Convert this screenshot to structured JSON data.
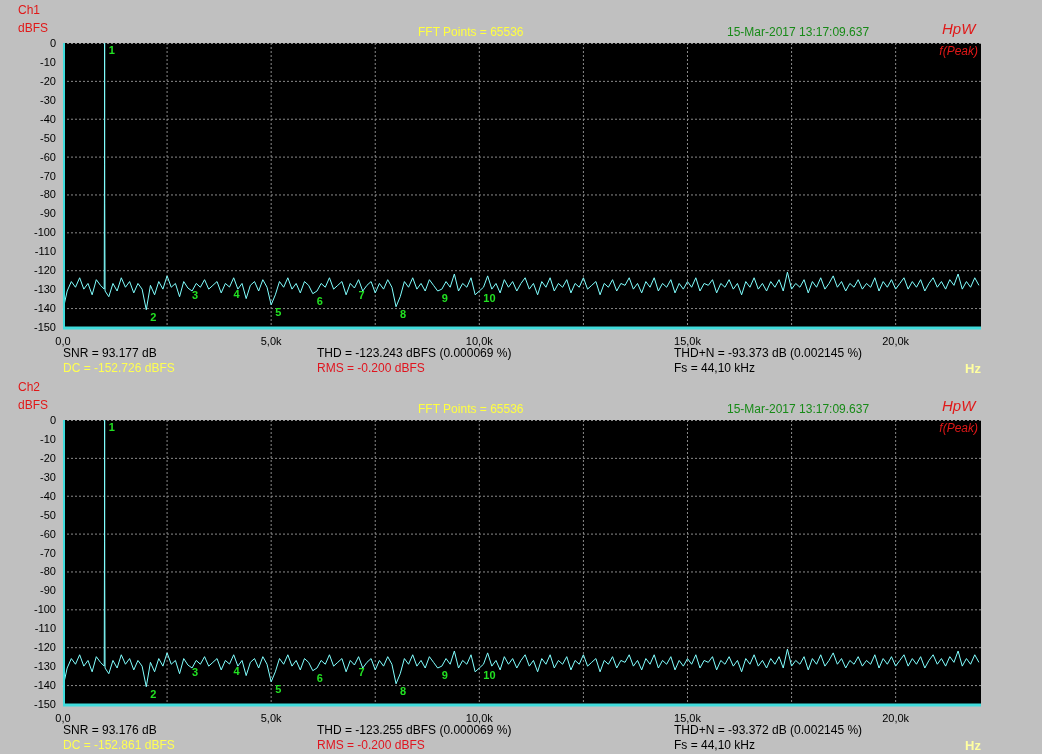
{
  "panels": [
    {
      "channel": "Ch1",
      "fft_points": "FFT Points = 65536",
      "timestamp": "15-Mar-2017 13:17:09.637",
      "brand": "HpW",
      "peak_mode": "f(Peak)",
      "chart_data": {
        "type": "line",
        "xlabel": "Hz",
        "ylabel": "dBFS",
        "grid": true,
        "xlim": [
          0,
          22050
        ],
        "ylim": [
          -150,
          0
        ],
        "xticks": [
          {
            "value": 0,
            "label": "0,0"
          },
          {
            "value": 5000,
            "label": "5,0k"
          },
          {
            "value": 10000,
            "label": "10,0k"
          },
          {
            "value": 15000,
            "label": "15,0k"
          },
          {
            "value": 20000,
            "label": "20,0k"
          }
        ],
        "yticks": [
          0,
          -10,
          -20,
          -30,
          -40,
          -50,
          -60,
          -70,
          -80,
          -90,
          -100,
          -110,
          -120,
          -130,
          -140,
          -150
        ],
        "x": [
          0,
          100,
          200,
          300,
          400,
          500,
          600,
          700,
          800,
          900,
          990,
          997,
          1000,
          1003,
          1010,
          1100,
          1200,
          1300,
          1400,
          1500,
          1600,
          1700,
          1800,
          1900,
          2000,
          2100,
          2200,
          2300,
          2400,
          2500,
          2600,
          2700,
          2800,
          2900,
          3000,
          3100,
          3200,
          3300,
          3400,
          3500,
          3600,
          3700,
          3800,
          3900,
          4000,
          4100,
          4200,
          4300,
          4400,
          4500,
          4600,
          4700,
          4800,
          4900,
          5000,
          5100,
          5200,
          5300,
          5400,
          5500,
          5600,
          5700,
          5800,
          5900,
          6000,
          6100,
          6200,
          6300,
          6400,
          6500,
          6600,
          6700,
          6800,
          6900,
          7000,
          7100,
          7200,
          7300,
          7400,
          7500,
          7600,
          7700,
          7800,
          7900,
          8000,
          8100,
          8200,
          8300,
          8400,
          8500,
          8600,
          8700,
          8800,
          8900,
          9000,
          9100,
          9200,
          9300,
          9400,
          9500,
          9600,
          9700,
          9800,
          9900,
          10000,
          10100,
          10200,
          10300,
          10400,
          10500,
          10600,
          10700,
          10800,
          10900,
          11000,
          11100,
          11200,
          11300,
          11400,
          11500,
          11600,
          11700,
          11800,
          11900,
          12000,
          12100,
          12200,
          12300,
          12400,
          12500,
          12600,
          12700,
          12800,
          12900,
          13000,
          13100,
          13200,
          13300,
          13400,
          13500,
          13600,
          13700,
          13800,
          13900,
          14000,
          14100,
          14200,
          14300,
          14400,
          14500,
          14600,
          14700,
          14800,
          14900,
          15000,
          15100,
          15200,
          15300,
          15400,
          15500,
          15600,
          15700,
          15800,
          15900,
          16000,
          16100,
          16200,
          16300,
          16400,
          16500,
          16600,
          16700,
          16800,
          16900,
          17000,
          17100,
          17200,
          17300,
          17400,
          17500,
          17600,
          17700,
          17800,
          17900,
          18000,
          18100,
          18200,
          18300,
          18400,
          18500,
          18600,
          18700,
          18800,
          18900,
          19000,
          19100,
          19200,
          19300,
          19400,
          19500,
          19600,
          19700,
          19800,
          19900,
          20000,
          20100,
          20200,
          20300,
          20400,
          20500,
          20600,
          20700,
          20800,
          20900,
          21000,
          21100,
          21200,
          21300,
          21400,
          21500,
          21600,
          21700,
          21800,
          21900,
          22000
        ],
        "series": [
          {
            "color": "#80ffff",
            "values": [
              -141,
              -131,
              -126,
              -129,
              -124,
              -130,
              -127,
              -133,
              -125,
              -128,
              -130,
              -64,
              0,
              -85,
              -131,
              -134,
              -127,
              -131,
              -124,
              -129,
              -126,
              -132,
              -127,
              -130,
              -140.9,
              -128,
              -133,
              -126,
              -130,
              -123,
              -129,
              -127,
              -134,
              -126,
              -129.4,
              -131,
              -127,
              -129,
              -125,
              -130,
              -128,
              -126,
              -132,
              -127,
              -128.9,
              -124,
              -130,
              -127,
              -135,
              -128,
              -126,
              -131,
              -125,
              -129,
              -138.3,
              -133,
              -126,
              -129,
              -124,
              -130,
              -127,
              -132,
              -126,
              -128,
              -132.4,
              -131,
              -127,
              -129,
              -124,
              -130,
              -128,
              -126,
              -133,
              -127,
              -129.4,
              -125,
              -131,
              -128,
              -126,
              -132,
              -127,
              -130,
              -125,
              -129,
              -139.3,
              -134,
              -126,
              -129,
              -124,
              -130,
              -127,
              -131,
              -125,
              -128,
              -131,
              -130,
              -126,
              -129,
              -122,
              -131,
              -127,
              -129,
              -124,
              -133,
              -131,
              -129,
              -123,
              -130,
              -127,
              -132,
              -125,
              -129,
              -126,
              -131,
              -127,
              -124,
              -130,
              -127,
              -133,
              -126,
              -129,
              -124,
              -131,
              -127,
              -129,
              -125,
              -132,
              -127,
              -129,
              -124,
              -130,
              -128,
              -126,
              -133,
              -127,
              -129,
              -125,
              -131,
              -127,
              -128,
              -124,
              -130,
              -127,
              -132,
              -126,
              -129,
              -124,
              -131,
              -127,
              -129,
              -125,
              -132,
              -127,
              -130,
              -126,
              -129,
              -124,
              -131,
              -127,
              -128,
              -125,
              -132,
              -127,
              -129,
              -125,
              -130,
              -127,
              -133,
              -126,
              -129,
              -124,
              -130,
              -127,
              -131,
              -126,
              -129,
              -125,
              -131,
              -121,
              -130,
              -127,
              -129,
              -125,
              -132,
              -126,
              -129,
              -124,
              -130,
              -127,
              -123,
              -129,
              -126,
              -131,
              -127,
              -129,
              -125,
              -130,
              -127,
              -129,
              -124,
              -131,
              -126,
              -129,
              -125,
              -130,
              -127,
              -124,
              -130,
              -126,
              -129,
              -125,
              -131,
              -127,
              -124,
              -129,
              -126,
              -130,
              -125,
              -128,
              -122,
              -130,
              -126,
              -129,
              -124,
              -128
            ]
          }
        ],
        "annotations": [
          {
            "text": "1",
            "x": 1000,
            "y": 0
          },
          {
            "text": "2",
            "x": 2000,
            "y": -140.9
          },
          {
            "text": "3",
            "x": 3000,
            "y": -129.4
          },
          {
            "text": "4",
            "x": 4000,
            "y": -128.9
          },
          {
            "text": "5",
            "x": 5000,
            "y": -138.3
          },
          {
            "text": "6",
            "x": 6000,
            "y": -132.4
          },
          {
            "text": "7",
            "x": 7000,
            "y": -129.4
          },
          {
            "text": "8",
            "x": 8000,
            "y": -139.3
          },
          {
            "text": "9",
            "x": 9000,
            "y": -131
          },
          {
            "text": "10",
            "x": 10000,
            "y": -131
          }
        ]
      },
      "measurements": [
        {
          "text": "SNR = 93.177 dB",
          "color": "#000000"
        },
        {
          "text": "THD = -123.243 dBFS (0.000069 %)",
          "color": "#000000"
        },
        {
          "text": "THD+N = -93.373 dB (0.002145 %)",
          "color": "#000000"
        },
        {
          "text": "DC = -152.726 dBFS",
          "color": "#ffff50"
        },
        {
          "text": "RMS = -0.200 dBFS",
          "color": "#e0141e"
        },
        {
          "text": "Fs = 44,10 kHz",
          "color": "#000000"
        }
      ]
    },
    {
      "channel": "Ch2",
      "fft_points": "FFT Points = 65536",
      "timestamp": "15-Mar-2017 13:17:09.637",
      "brand": "HpW",
      "peak_mode": "f(Peak)",
      "chart_data": {
        "type": "line",
        "xlabel": "Hz",
        "ylabel": "dBFS",
        "grid": true,
        "xlim": [
          0,
          22050
        ],
        "ylim": [
          -150,
          0
        ],
        "xticks": [
          {
            "value": 0,
            "label": "0,0"
          },
          {
            "value": 5000,
            "label": "5,0k"
          },
          {
            "value": 10000,
            "label": "10,0k"
          },
          {
            "value": 15000,
            "label": "15,0k"
          },
          {
            "value": 20000,
            "label": "20,0k"
          }
        ],
        "yticks": [
          0,
          -10,
          -20,
          -30,
          -40,
          -50,
          -60,
          -70,
          -80,
          -90,
          -100,
          -110,
          -120,
          -130,
          -140,
          -150
        ],
        "x": [
          0,
          100,
          200,
          300,
          400,
          500,
          600,
          700,
          800,
          900,
          990,
          997,
          1000,
          1003,
          1010,
          1100,
          1200,
          1300,
          1400,
          1500,
          1600,
          1700,
          1800,
          1900,
          2000,
          2100,
          2200,
          2300,
          2400,
          2500,
          2600,
          2700,
          2800,
          2900,
          3000,
          3100,
          3200,
          3300,
          3400,
          3500,
          3600,
          3700,
          3800,
          3900,
          4000,
          4100,
          4200,
          4300,
          4400,
          4500,
          4600,
          4700,
          4800,
          4900,
          5000,
          5100,
          5200,
          5300,
          5400,
          5500,
          5600,
          5700,
          5800,
          5900,
          6000,
          6100,
          6200,
          6300,
          6400,
          6500,
          6600,
          6700,
          6800,
          6900,
          7000,
          7100,
          7200,
          7300,
          7400,
          7500,
          7600,
          7700,
          7800,
          7900,
          8000,
          8100,
          8200,
          8300,
          8400,
          8500,
          8600,
          8700,
          8800,
          8900,
          9000,
          9100,
          9200,
          9300,
          9400,
          9500,
          9600,
          9700,
          9800,
          9900,
          10000,
          10100,
          10200,
          10300,
          10400,
          10500,
          10600,
          10700,
          10800,
          10900,
          11000,
          11100,
          11200,
          11300,
          11400,
          11500,
          11600,
          11700,
          11800,
          11900,
          12000,
          12100,
          12200,
          12300,
          12400,
          12500,
          12600,
          12700,
          12800,
          12900,
          13000,
          13100,
          13200,
          13300,
          13400,
          13500,
          13600,
          13700,
          13800,
          13900,
          14000,
          14100,
          14200,
          14300,
          14400,
          14500,
          14600,
          14700,
          14800,
          14900,
          15000,
          15100,
          15200,
          15300,
          15400,
          15500,
          15600,
          15700,
          15800,
          15900,
          16000,
          16100,
          16200,
          16300,
          16400,
          16500,
          16600,
          16700,
          16800,
          16900,
          17000,
          17100,
          17200,
          17300,
          17400,
          17500,
          17600,
          17700,
          17800,
          17900,
          18000,
          18100,
          18200,
          18300,
          18400,
          18500,
          18600,
          18700,
          18800,
          18900,
          19000,
          19100,
          19200,
          19300,
          19400,
          19500,
          19600,
          19700,
          19800,
          19900,
          20000,
          20100,
          20200,
          20300,
          20400,
          20500,
          20600,
          20700,
          20800,
          20900,
          21000,
          21100,
          21200,
          21300,
          21400,
          21500,
          21600,
          21700,
          21800,
          21900,
          22000
        ],
        "series": [
          {
            "color": "#80ffff",
            "values": [
              -141,
              -131,
              -126,
              -129,
              -124,
              -130,
              -127,
              -133,
              -125,
              -128,
              -130,
              -64,
              0,
              -85,
              -131,
              -134,
              -127,
              -131,
              -124,
              -129,
              -126,
              -132,
              -127,
              -130,
              -140.9,
              -128,
              -133,
              -126,
              -130,
              -123,
              -129,
              -127,
              -134,
              -126,
              -129.4,
              -131,
              -127,
              -129,
              -125,
              -130,
              -128,
              -126,
              -132,
              -127,
              -128.9,
              -124,
              -130,
              -127,
              -135,
              -128,
              -126,
              -131,
              -125,
              -129,
              -138.3,
              -133,
              -126,
              -129,
              -124,
              -130,
              -127,
              -132,
              -126,
              -128,
              -132.4,
              -131,
              -127,
              -129,
              -124,
              -130,
              -128,
              -126,
              -133,
              -127,
              -129.4,
              -125,
              -131,
              -128,
              -126,
              -132,
              -127,
              -130,
              -125,
              -129,
              -139.3,
              -134,
              -126,
              -129,
              -124,
              -130,
              -127,
              -131,
              -125,
              -128,
              -131,
              -130,
              -126,
              -129,
              -122,
              -131,
              -127,
              -129,
              -124,
              -133,
              -131,
              -129,
              -123,
              -130,
              -127,
              -132,
              -125,
              -129,
              -126,
              -131,
              -127,
              -124,
              -130,
              -127,
              -133,
              -126,
              -129,
              -124,
              -131,
              -127,
              -129,
              -125,
              -132,
              -127,
              -129,
              -124,
              -130,
              -128,
              -126,
              -133,
              -127,
              -129,
              -125,
              -131,
              -127,
              -128,
              -124,
              -130,
              -127,
              -132,
              -126,
              -129,
              -124,
              -131,
              -127,
              -129,
              -125,
              -132,
              -127,
              -130,
              -126,
              -129,
              -124,
              -131,
              -127,
              -128,
              -125,
              -132,
              -127,
              -129,
              -125,
              -130,
              -127,
              -133,
              -126,
              -129,
              -124,
              -130,
              -127,
              -131,
              -126,
              -129,
              -125,
              -131,
              -121,
              -130,
              -127,
              -129,
              -125,
              -132,
              -126,
              -129,
              -124,
              -130,
              -127,
              -123,
              -129,
              -126,
              -131,
              -127,
              -129,
              -125,
              -130,
              -127,
              -129,
              -124,
              -131,
              -126,
              -129,
              -125,
              -130,
              -127,
              -124,
              -130,
              -126,
              -129,
              -125,
              -131,
              -127,
              -124,
              -129,
              -126,
              -130,
              -125,
              -128,
              -122,
              -130,
              -126,
              -129,
              -124,
              -128
            ]
          }
        ],
        "annotations": [
          {
            "text": "1",
            "x": 1000,
            "y": 0
          },
          {
            "text": "2",
            "x": 2000,
            "y": -140.9
          },
          {
            "text": "3",
            "x": 3000,
            "y": -129.4
          },
          {
            "text": "4",
            "x": 4000,
            "y": -128.9
          },
          {
            "text": "5",
            "x": 5000,
            "y": -138.3
          },
          {
            "text": "6",
            "x": 6000,
            "y": -132.4
          },
          {
            "text": "7",
            "x": 7000,
            "y": -129.4
          },
          {
            "text": "8",
            "x": 8000,
            "y": -139.3
          },
          {
            "text": "9",
            "x": 9000,
            "y": -131
          },
          {
            "text": "10",
            "x": 10000,
            "y": -131
          }
        ]
      },
      "measurements": [
        {
          "text": "SNR = 93.176 dB",
          "color": "#000000"
        },
        {
          "text": "THD = -123.255 dBFS (0.000069 %)",
          "color": "#000000"
        },
        {
          "text": "THD+N = -93.372 dB (0.002145 %)",
          "color": "#000000"
        },
        {
          "text": "DC = -152.861 dBFS",
          "color": "#ffff50"
        },
        {
          "text": "RMS = -0.200 dBFS",
          "color": "#e0141e"
        },
        {
          "text": "Fs = 44,10 kHz",
          "color": "#000000"
        }
      ]
    }
  ]
}
